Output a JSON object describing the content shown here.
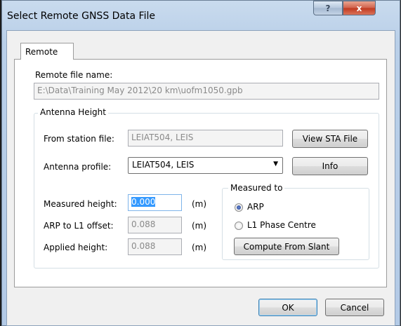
{
  "window": {
    "title": "Select Remote GNSS Data File",
    "help_glyph": "?",
    "close_glyph": "x"
  },
  "tabs": [
    {
      "label": "Remote"
    }
  ],
  "remote_file": {
    "label": "Remote file name:",
    "value": "E:\\Data\\Training May 2012\\20 km\\uofm1050.gpb"
  },
  "antenna_height": {
    "legend": "Antenna Height",
    "station_file_label": "From station file:",
    "station_file_value": "LEIAT504, LEIS",
    "view_sta_button": "View STA File",
    "profile_label": "Antenna profile:",
    "profile_value": "LEIAT504, LEIS",
    "info_button": "Info",
    "measured_height_label": "Measured height:",
    "measured_height_value": "0.000",
    "arp_offset_label": "ARP to L1 offset:",
    "arp_offset_value": "0.088",
    "applied_height_label": "Applied height:",
    "applied_height_value": "0.088",
    "unit": "(m)"
  },
  "measured_to": {
    "legend": "Measured to",
    "options": [
      {
        "label": "ARP",
        "selected": true
      },
      {
        "label": "L1 Phase Centre",
        "selected": false
      }
    ],
    "compute_button": "Compute From Slant"
  },
  "footer": {
    "ok_button": "OK",
    "cancel_button": "Cancel"
  }
}
